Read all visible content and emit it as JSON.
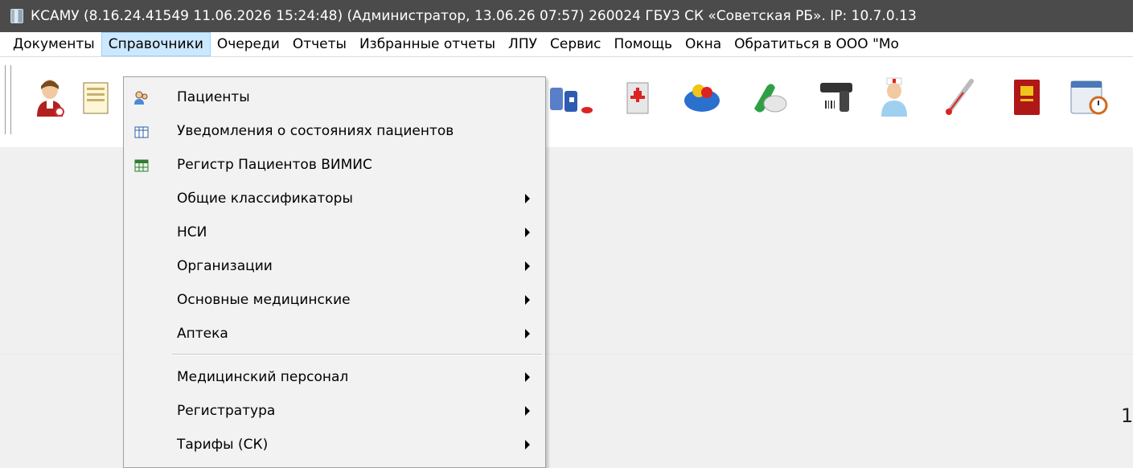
{
  "window": {
    "title": "КСАМУ (8.16.24.41549 11.06.2026 15:24:48) (Администратор, 13.06.26 07:57)  260024 ГБУЗ СК «Советская РБ». IP: 10.7.0.13",
    "app_icon": "app-icon"
  },
  "menubar": {
    "items": [
      {
        "label": "Документы"
      },
      {
        "label": "Справочники"
      },
      {
        "label": "Очереди"
      },
      {
        "label": "Отчеты"
      },
      {
        "label": "Избранные отчеты"
      },
      {
        "label": "ЛПУ"
      },
      {
        "label": "Сервис"
      },
      {
        "label": "Помощь"
      },
      {
        "label": "Окна"
      },
      {
        "label": "Обратиться в ООО \"Мо"
      }
    ],
    "active_index": 1,
    "active_colors": {
      "background": "#cce8ff",
      "border": "#99d1ff"
    }
  },
  "toolbar": {
    "icons": [
      "doctor-icon",
      "document-list-icon",
      "medicine-bottles-icon",
      "medical-folder-icon",
      "pill-basket-icon",
      "pills-icon",
      "barcode-scanner-icon",
      "nurse-icon",
      "thermometer-icon",
      "medical-book-icon",
      "schedule-calendar-icon"
    ]
  },
  "dropdown": {
    "items": [
      {
        "label": "Пациенты",
        "icon": "patients-icon",
        "submenu": false
      },
      {
        "label": "Уведомления о состояниях пациентов",
        "icon": "table-icon",
        "submenu": false
      },
      {
        "label": "Регистр Пациентов ВИМИС",
        "icon": "grid-icon",
        "submenu": false
      },
      {
        "label": "Общие классификаторы",
        "icon": "",
        "submenu": true
      },
      {
        "label": "НСИ",
        "icon": "",
        "submenu": true
      },
      {
        "label": "Организации",
        "icon": "",
        "submenu": true
      },
      {
        "label": "Основные медицинские",
        "icon": "",
        "submenu": true
      },
      {
        "label": "Аптека",
        "icon": "",
        "submenu": true
      },
      {
        "label": "Медицинский персонал",
        "icon": "",
        "submenu": true
      },
      {
        "label": "Регистратура",
        "icon": "",
        "submenu": true
      },
      {
        "label": "Тарифы (СК)",
        "icon": "",
        "submenu": true
      }
    ]
  },
  "corner_text": "1",
  "colors": {
    "titlebar": "#4b4b4b",
    "menu_bg": "#f2f2f2"
  }
}
